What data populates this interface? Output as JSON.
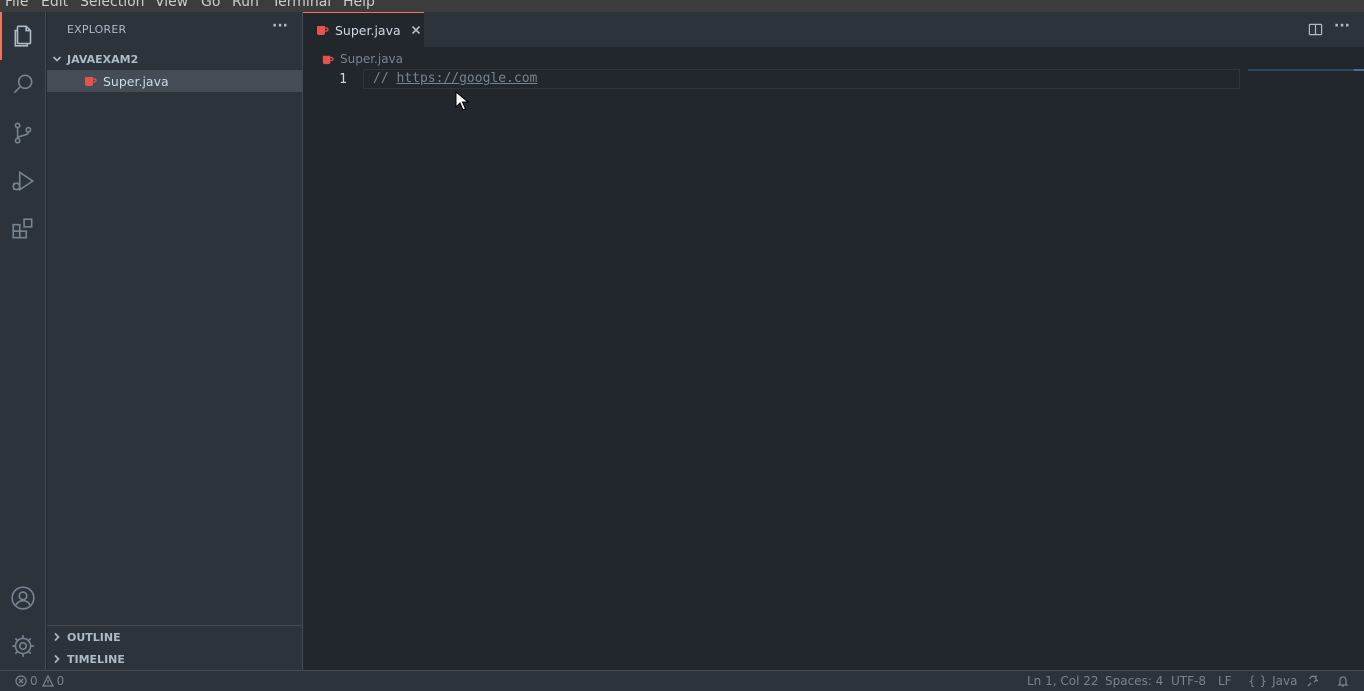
{
  "menubar": {
    "items": [
      "File",
      "Edit",
      "Selection",
      "View",
      "Go",
      "Run",
      "Terminal",
      "Help"
    ]
  },
  "activity_bar": {
    "items": [
      "files-icon",
      "search-icon",
      "source-control-icon",
      "run-debug-icon",
      "extensions-icon"
    ],
    "bottom_items": [
      "account-icon",
      "gear-icon"
    ]
  },
  "sidebar": {
    "title": "EXPLORER",
    "more_label": "···",
    "folder": "JAVAEXAM2",
    "files": [
      {
        "label": "Super.java",
        "icon": "java-icon"
      }
    ],
    "sections": [
      "OUTLINE",
      "TIMELINE"
    ]
  },
  "tabs": [
    {
      "label": "Super.java",
      "icon": "java-icon",
      "active": true
    }
  ],
  "editor_actions": {
    "more_label": "···"
  },
  "editor": {
    "breadcrumb": "Super.java",
    "lines": [
      {
        "number": "1",
        "prefix": "// ",
        "url": "https://google.com"
      }
    ]
  },
  "status_bar": {
    "errors": "0",
    "warnings": "0",
    "position": "Ln 1, Col 22",
    "indent": "Spaces: 4",
    "encoding": "UTF-8",
    "eol": "LF",
    "language": "Java",
    "language_icon": "{ }"
  },
  "colors": {
    "accent": "#ec775c",
    "java_icon": "#e5534b",
    "editor_bg": "#22272e",
    "sidebar_bg": "#2d333b"
  }
}
